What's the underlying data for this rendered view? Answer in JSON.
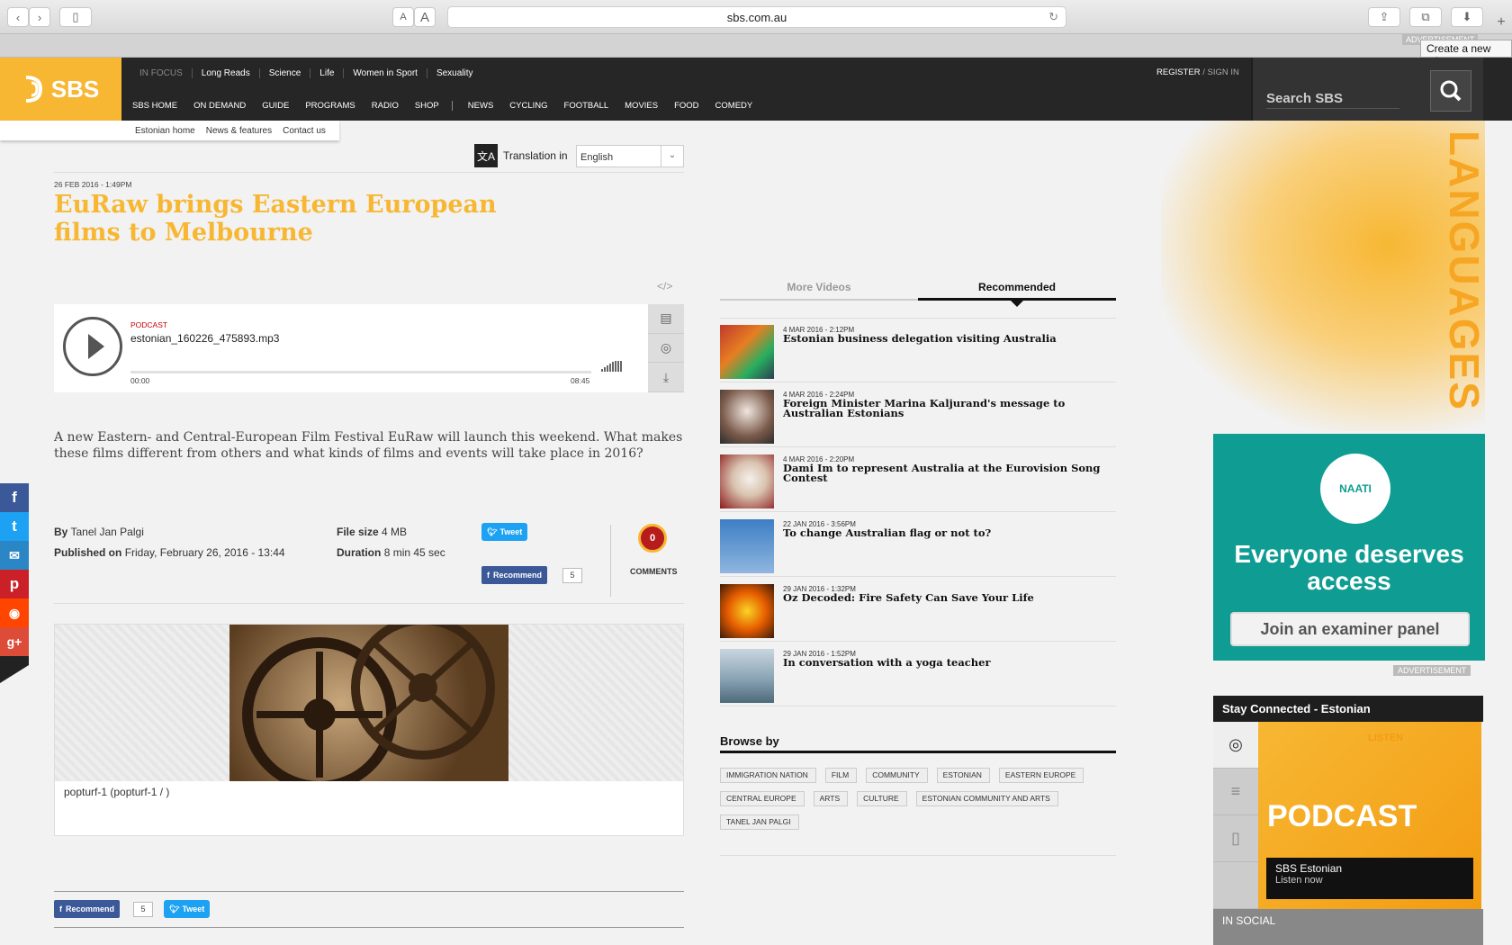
{
  "browser": {
    "url": "sbs.com.au",
    "tooltip": "Create a new tab",
    "ad_label": "ADVERTISEMENT",
    "font_small": "A",
    "font_large": "A"
  },
  "header": {
    "logo": "SBS",
    "in_focus": [
      "IN FOCUS",
      "Long Reads",
      "Science",
      "Life",
      "Women in Sport",
      "Sexuality"
    ],
    "main_nav": [
      "SBS HOME",
      "ON DEMAND",
      "GUIDE",
      "PROGRAMS",
      "RADIO",
      "SHOP",
      "NEWS",
      "CYCLING",
      "FOOTBALL",
      "MOVIES",
      "FOOD",
      "COMEDY"
    ],
    "register": "REGISTER",
    "sign_in": "SIGN IN",
    "search_placeholder": "Search SBS",
    "sub_nav": [
      "Estonian home",
      "News & features",
      "Contact us"
    ]
  },
  "translation": {
    "label": "Translation in",
    "language": "English"
  },
  "article": {
    "date": "26 FEB 2016 - 1:49PM",
    "title": "EuRaw brings Eastern European films to Melbourne",
    "lead": "A new Eastern- and Central-European Film Festival EuRaw will launch this weekend. What makes these films different from others and what kinds of films and events will take place in 2016?",
    "by_label": "By",
    "author": "Tanel Jan Palgi",
    "published_label": "Published on",
    "published": "Friday, February 26, 2016 - 13:44",
    "filesize_label": "File size",
    "filesize": "4 MB",
    "duration_label": "Duration",
    "duration": "8 min 45 sec",
    "tweet": "Tweet",
    "recommend": "Recommend",
    "recommend_count": "5",
    "comments_count": "0",
    "comments_label": "COMMENTS",
    "caption": "popturf-1 (popturf-1 / )"
  },
  "player": {
    "tag": "PODCAST",
    "file": "estonian_160226_475893.mp3",
    "start": "00:00",
    "end": "08:45",
    "progress": 0
  },
  "right": {
    "tab_more": "More Videos",
    "tab_recommended": "Recommended",
    "items": [
      {
        "date": "4 MAR 2016 - 2:12PM",
        "title": "Estonian business delegation visiting Australia"
      },
      {
        "date": "4 MAR 2016 - 2:24PM",
        "title": "Foreign Minister Marina Kaljurand's message to Australian Estonians"
      },
      {
        "date": "4 MAR 2016 - 2:20PM",
        "title": "Dami Im to represent Australia at the Eurovision Song Contest"
      },
      {
        "date": "22 JAN 2016 - 3:56PM",
        "title": "To change Australian flag or not to?"
      },
      {
        "date": "29 JAN 2016 - 1:32PM",
        "title": "Oz Decoded: Fire Safety Can Save Your Life"
      },
      {
        "date": "29 JAN 2016 - 1:52PM",
        "title": "In conversation with a yoga teacher"
      }
    ],
    "browse_by": "Browse by",
    "tags": [
      "IMMIGRATION NATION",
      "FILM",
      "COMMUNITY",
      "ESTONIAN",
      "EASTERN EUROPE",
      "CENTRAL EUROPE",
      "ARTS",
      "CULTURE",
      "ESTONIAN COMMUNITY AND ARTS",
      "TANEL JAN PALGI"
    ]
  },
  "sidebar": {
    "languages": "LANGUAGES",
    "ad_headline": "Everyone deserves access",
    "ad_button": "Join an examiner panel",
    "ad_label": "ADVERTISEMENT",
    "stay_connected": "Stay Connected - Estonian",
    "listen": "LISTEN",
    "podcast": "PODCAST",
    "podcast_name": "SBS Estonian",
    "podcast_cta": "Listen now",
    "in_social": "IN SOCIAL"
  }
}
